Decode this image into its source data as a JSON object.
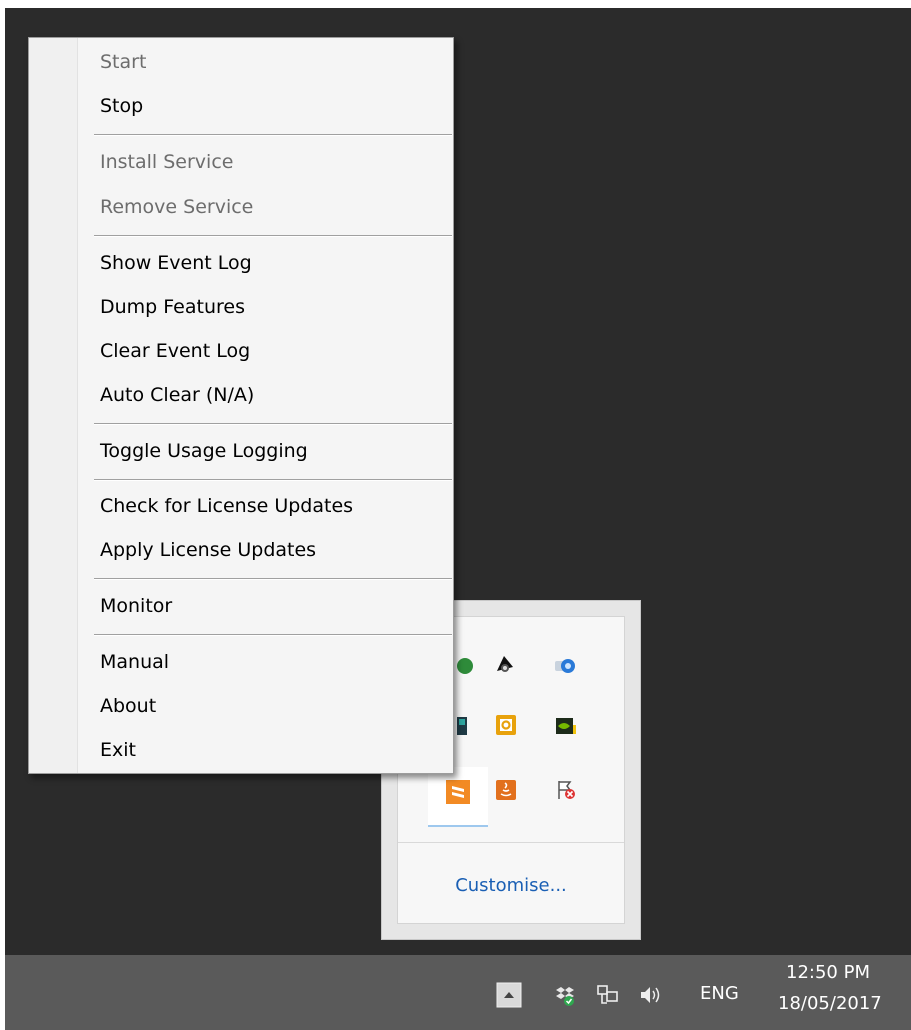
{
  "context_menu": {
    "items": [
      {
        "label": "Start",
        "enabled": false
      },
      {
        "label": "Stop",
        "enabled": true
      },
      {
        "label": "Install Service",
        "enabled": false
      },
      {
        "label": "Remove Service",
        "enabled": false
      },
      {
        "label": "Show Event Log",
        "enabled": true
      },
      {
        "label": "Dump Features",
        "enabled": true
      },
      {
        "label": "Clear Event Log",
        "enabled": true
      },
      {
        "label": "Auto Clear (N/A)",
        "enabled": true
      },
      {
        "label": "Toggle Usage Logging",
        "enabled": true
      },
      {
        "label": "Check for License Updates",
        "enabled": true
      },
      {
        "label": "Apply License Updates",
        "enabled": true
      },
      {
        "label": "Monitor",
        "enabled": true
      },
      {
        "label": "Manual",
        "enabled": true
      },
      {
        "label": "About",
        "enabled": true
      },
      {
        "label": "Exit",
        "enabled": true
      }
    ]
  },
  "tray_overflow": {
    "customise_label": "Customise...",
    "icons": [
      "green-circle-icon",
      "pirate-skull-icon",
      "drive-globe-icon",
      "teal-app-icon",
      "outlook-icon",
      "nvidia-icon",
      "sublime-text-icon",
      "java-icon",
      "action-center-flag-icon"
    ]
  },
  "taskbar": {
    "language": "ENG",
    "time": "12:50 PM",
    "date": "18/05/2017",
    "tray_icons": [
      "show-hidden-icons-button",
      "dropbox-icon",
      "network-icon",
      "volume-icon"
    ]
  },
  "colors": {
    "desktop": "#2b2b2b",
    "taskbar": "#5a5a5a",
    "link": "#1a5fb4",
    "disabled_text": "#6d6d6d"
  }
}
